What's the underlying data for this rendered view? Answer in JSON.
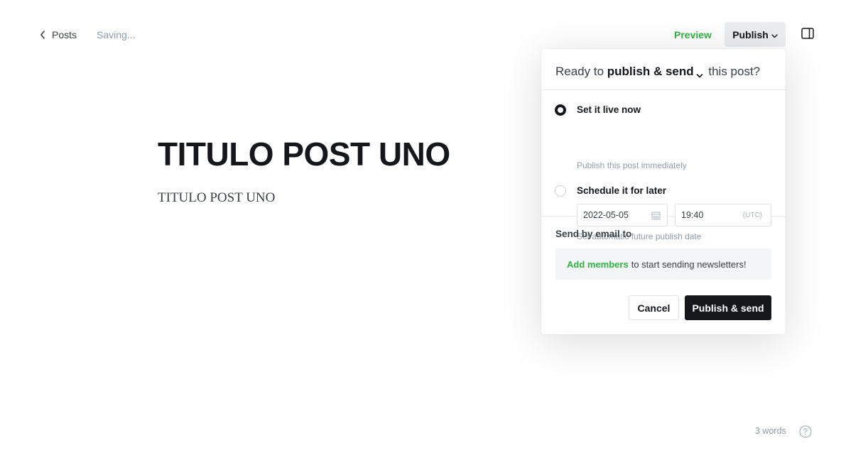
{
  "nav": {
    "back_label": "Posts",
    "status": "Saving..."
  },
  "toolbar": {
    "preview_label": "Preview",
    "publish_label": "Publish",
    "accent_color": "#2fb543"
  },
  "editor": {
    "title": "TITULO POST UNO",
    "body": "TITULO POST UNO"
  },
  "publish_menu": {
    "header_prefix": "Ready to",
    "header_action": "publish & send",
    "header_suffix": "this post?",
    "options": [
      {
        "title": "Set it live now",
        "subtitle": "Publish this post immediately",
        "selected": true
      },
      {
        "title": "Schedule it for later",
        "subtitle": "Set automatic future publish date",
        "selected": false
      }
    ],
    "schedule": {
      "date": "2022-05-05",
      "time": "19:40",
      "timezone": "(UTC)"
    },
    "email": {
      "title": "Send by email to",
      "link_text": "Add members",
      "message": "to start sending newsletters!"
    },
    "cancel_label": "Cancel",
    "confirm_label": "Publish & send"
  },
  "footer": {
    "word_count": "3 words"
  },
  "icons": {
    "back": "chevron-left-icon",
    "publish_caret": "chevron-down-icon",
    "sidebar": "sidebar-toggle-icon",
    "calendar": "calendar-icon",
    "help": "question-circle-icon"
  }
}
